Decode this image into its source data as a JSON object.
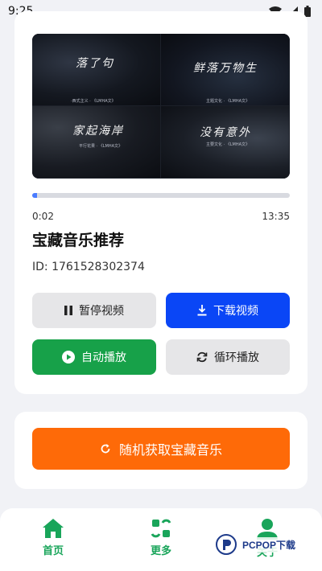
{
  "status_bar": {
    "time": "9:25",
    "icons": [
      "wifi-icon",
      "cell-signal-icon",
      "battery-icon"
    ]
  },
  "video": {
    "stills": [
      {
        "title": "落了句",
        "subtitle": "·西式主义 · 《LMHA文》"
      },
      {
        "title": "鲜落万物生",
        "subtitle": "主题文化 · 《LMHA文》"
      },
      {
        "title": "家起海岸",
        "subtitle": "平行花果 · 《LMHA文》"
      },
      {
        "title": "没有意外",
        "subtitle": "主要文化 · 《LMHA文》"
      }
    ],
    "progress": 0.02,
    "current_time": "0:02",
    "total_time": "13:35"
  },
  "track": {
    "title": "宝藏音乐推荐",
    "id": "ID: 1761528302374"
  },
  "buttons": {
    "pause": "暂停视频",
    "download": "下载视频",
    "auto_play": "自动播放",
    "loop_play": "循环播放",
    "random": "随机获取宝藏音乐"
  },
  "nav": {
    "home": "首页",
    "more": "更多",
    "about": "关于"
  },
  "watermark": "PCPOP下载",
  "colors": {
    "download": "#0a46f6",
    "auto_play": "#17a149",
    "random": "#fe6a08",
    "nav_accent": "#19a55a",
    "progress": "#4a7cff"
  }
}
